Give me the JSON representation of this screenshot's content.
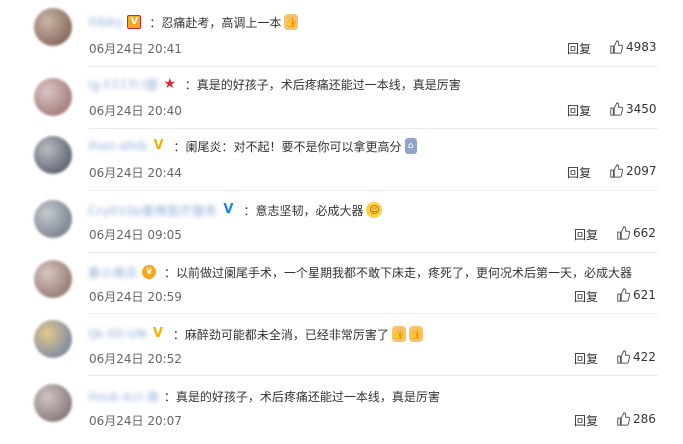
{
  "comments": [
    {
      "user": "ilibby",
      "badge": "v-gold",
      "badge_text": "V",
      "text": "：忍痛赴考，高调上一本",
      "emojis": [
        "thumb"
      ],
      "time": "06月24日 20:41",
      "reply": "回复",
      "likes": "4983",
      "avatar_colors": [
        "#c9b7a8",
        "#7c5a4e"
      ]
    },
    {
      "user": "ig-f.f.f.fl:l瑟",
      "badge": "star",
      "badge_text": "★",
      "text": "：真是的好孩子，术后疼痛还能过一本线，真是厉害",
      "emojis": [],
      "time": "06月24日 20:40",
      "reply": "回复",
      "likes": "3450",
      "avatar_colors": [
        "#d8c6c6",
        "#9c6e6e"
      ]
    },
    {
      "user": "ihsn-ahib",
      "badge": "v-yellow",
      "badge_text": "V",
      "text": "：阑尾炎：对不起！要不是你可以拿更高分",
      "emojis": [
        "figure"
      ],
      "time": "06月24日 20:44",
      "reply": "回复",
      "likes": "2097",
      "avatar_colors": [
        "#b9bcc2",
        "#4f5462"
      ]
    },
    {
      "user": "Cry010p匿微医疗服务",
      "badge": "v-blue",
      "badge_text": "V",
      "text": "：意志坚韧，必成大器",
      "emojis": [
        "face"
      ],
      "time": "06月24日 09:05",
      "reply": "回复",
      "likes": "662",
      "avatar_colors": [
        "#c4c9cf",
        "#6f7782"
      ]
    },
    {
      "user": "娄小南瓜",
      "badge": "crown",
      "badge_text": "♛",
      "text": "：以前做过阑尾手术，一个星期我都不敢下床走，疼死了，更何况术后第一天，必成大器",
      "emojis": [],
      "time": "06月24日 20:59",
      "reply": "回复",
      "likes": "621",
      "avatar_colors": [
        "#d7c6c0",
        "#8a6e66"
      ]
    },
    {
      "user": "ijk-llll-UN",
      "badge": "v-yellow",
      "badge_text": "V",
      "text": "：麻醉劲可能都未全消，已经非常厉害了",
      "emojis": [
        "thumb",
        "thumb"
      ],
      "time": "06月24日 20:52",
      "reply": "回复",
      "likes": "422",
      "avatar_colors": [
        "#e2c98e",
        "#6b7fa6"
      ]
    },
    {
      "user": "ihiuk-kcl-鱼",
      "badge": "",
      "badge_text": "",
      "text": "：真是的好孩子，术后疼痛还能过一本线，真是厉害",
      "emojis": [],
      "time": "06月24日 20:07",
      "reply": "回复",
      "likes": "286",
      "avatar_colors": [
        "#cfc3c3",
        "#7d6d6d"
      ]
    }
  ]
}
